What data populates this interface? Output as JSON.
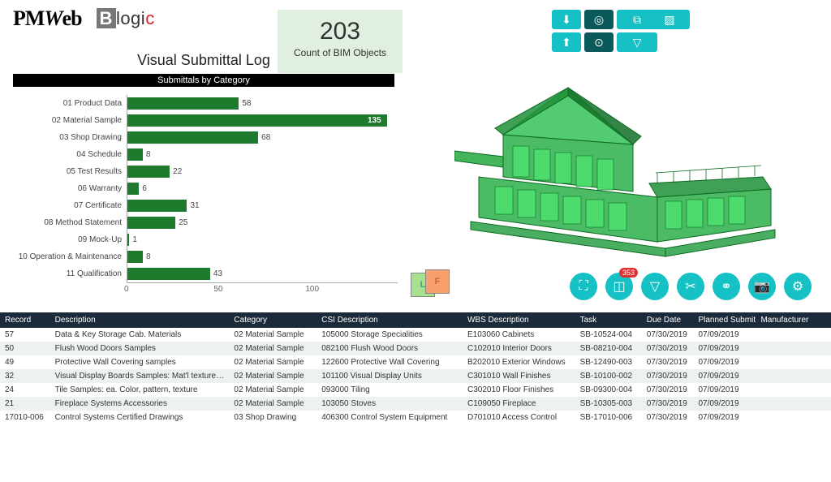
{
  "header": {
    "logo1": "PMWeb",
    "logo2_b": "B",
    "logo2_rest": "logi",
    "logo2_c": "c",
    "metric_value": "203",
    "metric_label": "Count of BIM Objects",
    "page_title": "Visual Submittal Log",
    "chart_title": "Submittals by Category"
  },
  "chart_data": {
    "type": "bar",
    "orientation": "horizontal",
    "title": "Submittals by Category",
    "xlabel": "",
    "ylabel": "",
    "xlim": [
      0,
      135
    ],
    "x_ticks": [
      0,
      50,
      100
    ],
    "categories": [
      "01 Product Data",
      "02 Material Sample",
      "03 Shop Drawing",
      "04 Schedule",
      "05 Test Results",
      "06 Warranty",
      "07 Certificate",
      "08 Method Statement",
      "09 Mock-Up",
      "10 Operation & Maintenance",
      "11 Qualification"
    ],
    "values": [
      58,
      135,
      68,
      8,
      22,
      6,
      31,
      25,
      1,
      8,
      43
    ]
  },
  "viewer": {
    "top_buttons": [
      "down",
      "target",
      "copy",
      "pattern",
      "up",
      "center",
      "filter"
    ],
    "bottom_buttons": [
      "expand",
      "select",
      "filter-clear",
      "cut",
      "link",
      "camera",
      "settings"
    ],
    "select_badge": "353",
    "cube_l": "L",
    "cube_f": "F"
  },
  "table": {
    "columns": [
      "Record",
      "Description",
      "Category",
      "CSI Description",
      "WBS Description",
      "Task",
      "Due Date",
      "Planned Submit",
      "Manufacturer"
    ],
    "rows": [
      {
        "rec": "57",
        "desc": "Data & Key Storage Cab. Materials",
        "cat": "02 Material Sample",
        "csi": "105000 Storage Specialities",
        "wbs": "E103060 Cabinets",
        "task": "SB-10524-004",
        "due": "07/30/2019",
        "plan": "07/09/2019",
        "man": ""
      },
      {
        "rec": "50",
        "desc": "Flush Wood Doors Samples",
        "cat": "02 Material Sample",
        "csi": "082100 Flush Wood Doors",
        "wbs": "C102010 Interior Doors",
        "task": "SB-08210-004",
        "due": "07/30/2019",
        "plan": "07/09/2019",
        "man": ""
      },
      {
        "rec": "49",
        "desc": "Protective Wall Covering samples",
        "cat": "02 Material Sample",
        "csi": "122600 Protective Wall Covering",
        "wbs": "B202010 Exterior Windows",
        "task": "SB-12490-003",
        "due": "07/30/2019",
        "plan": "07/09/2019",
        "man": ""
      },
      {
        "rec": "32",
        "desc": "Visual Display Boards Samples: Mat'l texture of boards",
        "cat": "02 Material Sample",
        "csi": "101100 Visual Display Units",
        "wbs": "C301010 Wall Finishes",
        "task": "SB-10100-002",
        "due": "07/30/2019",
        "plan": "07/09/2019",
        "man": ""
      },
      {
        "rec": "24",
        "desc": "Tile Samples: ea. Color, pattern, texture",
        "cat": "02 Material Sample",
        "csi": "093000 Tiling",
        "wbs": "C302010 Floor Finishes",
        "task": "SB-09300-004",
        "due": "07/30/2019",
        "plan": "07/09/2019",
        "man": ""
      },
      {
        "rec": "21",
        "desc": "Fireplace Systems Accessories",
        "cat": "02 Material Sample",
        "csi": "103050 Stoves",
        "wbs": "C109050 Fireplace",
        "task": "SB-10305-003",
        "due": "07/30/2019",
        "plan": "07/09/2019",
        "man": ""
      },
      {
        "rec": "17010-006",
        "desc": "Control Systems Certified Drawings",
        "cat": "03 Shop Drawing",
        "csi": "406300 Control System Equipment",
        "wbs": "D701010 Access Control",
        "task": "SB-17010-006",
        "due": "07/30/2019",
        "plan": "07/09/2019",
        "man": ""
      }
    ]
  }
}
